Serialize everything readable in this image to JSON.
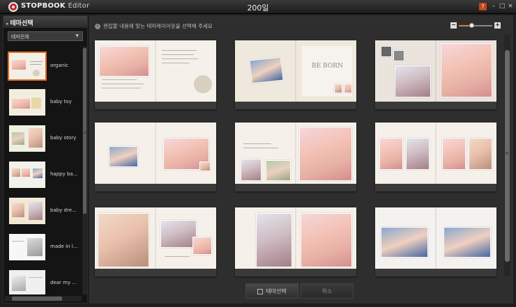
{
  "app": {
    "name": "STOPBOOK",
    "name_suffix": "Editor",
    "window_title": "200일",
    "help_label": "?"
  },
  "window_controls": {
    "minimize": "–",
    "maximize": "□",
    "close": "×"
  },
  "sidebar": {
    "title": "테마선택",
    "filter": {
      "value": "테마전체"
    },
    "themes": [
      {
        "label": "organic"
      },
      {
        "label": "baby toy"
      },
      {
        "label": "baby story"
      },
      {
        "label": "happy ba..."
      },
      {
        "label": "baby dre..."
      },
      {
        "label": "made in l..."
      },
      {
        "label": "dear my ..."
      }
    ]
  },
  "main": {
    "instruction": "편집할 내용에 맞는 테마레이아웃을 선택해 주세요",
    "info_icon": "i",
    "zoom": {
      "minus": "−",
      "plus": "+",
      "level": 0.4
    },
    "layouts": [
      {
        "text": ""
      },
      {
        "text": "BE BORN"
      },
      {
        "text": ""
      },
      {
        "text": ""
      },
      {
        "text": ""
      },
      {
        "text": ""
      },
      {
        "text": ""
      },
      {
        "text": ""
      },
      {
        "text": ""
      }
    ]
  },
  "buttons": {
    "select": "테마선택",
    "cancel": "취소"
  },
  "colors": {
    "accent": "#e06a1e",
    "background": "#2e2e2e",
    "help": "#c1461c"
  }
}
